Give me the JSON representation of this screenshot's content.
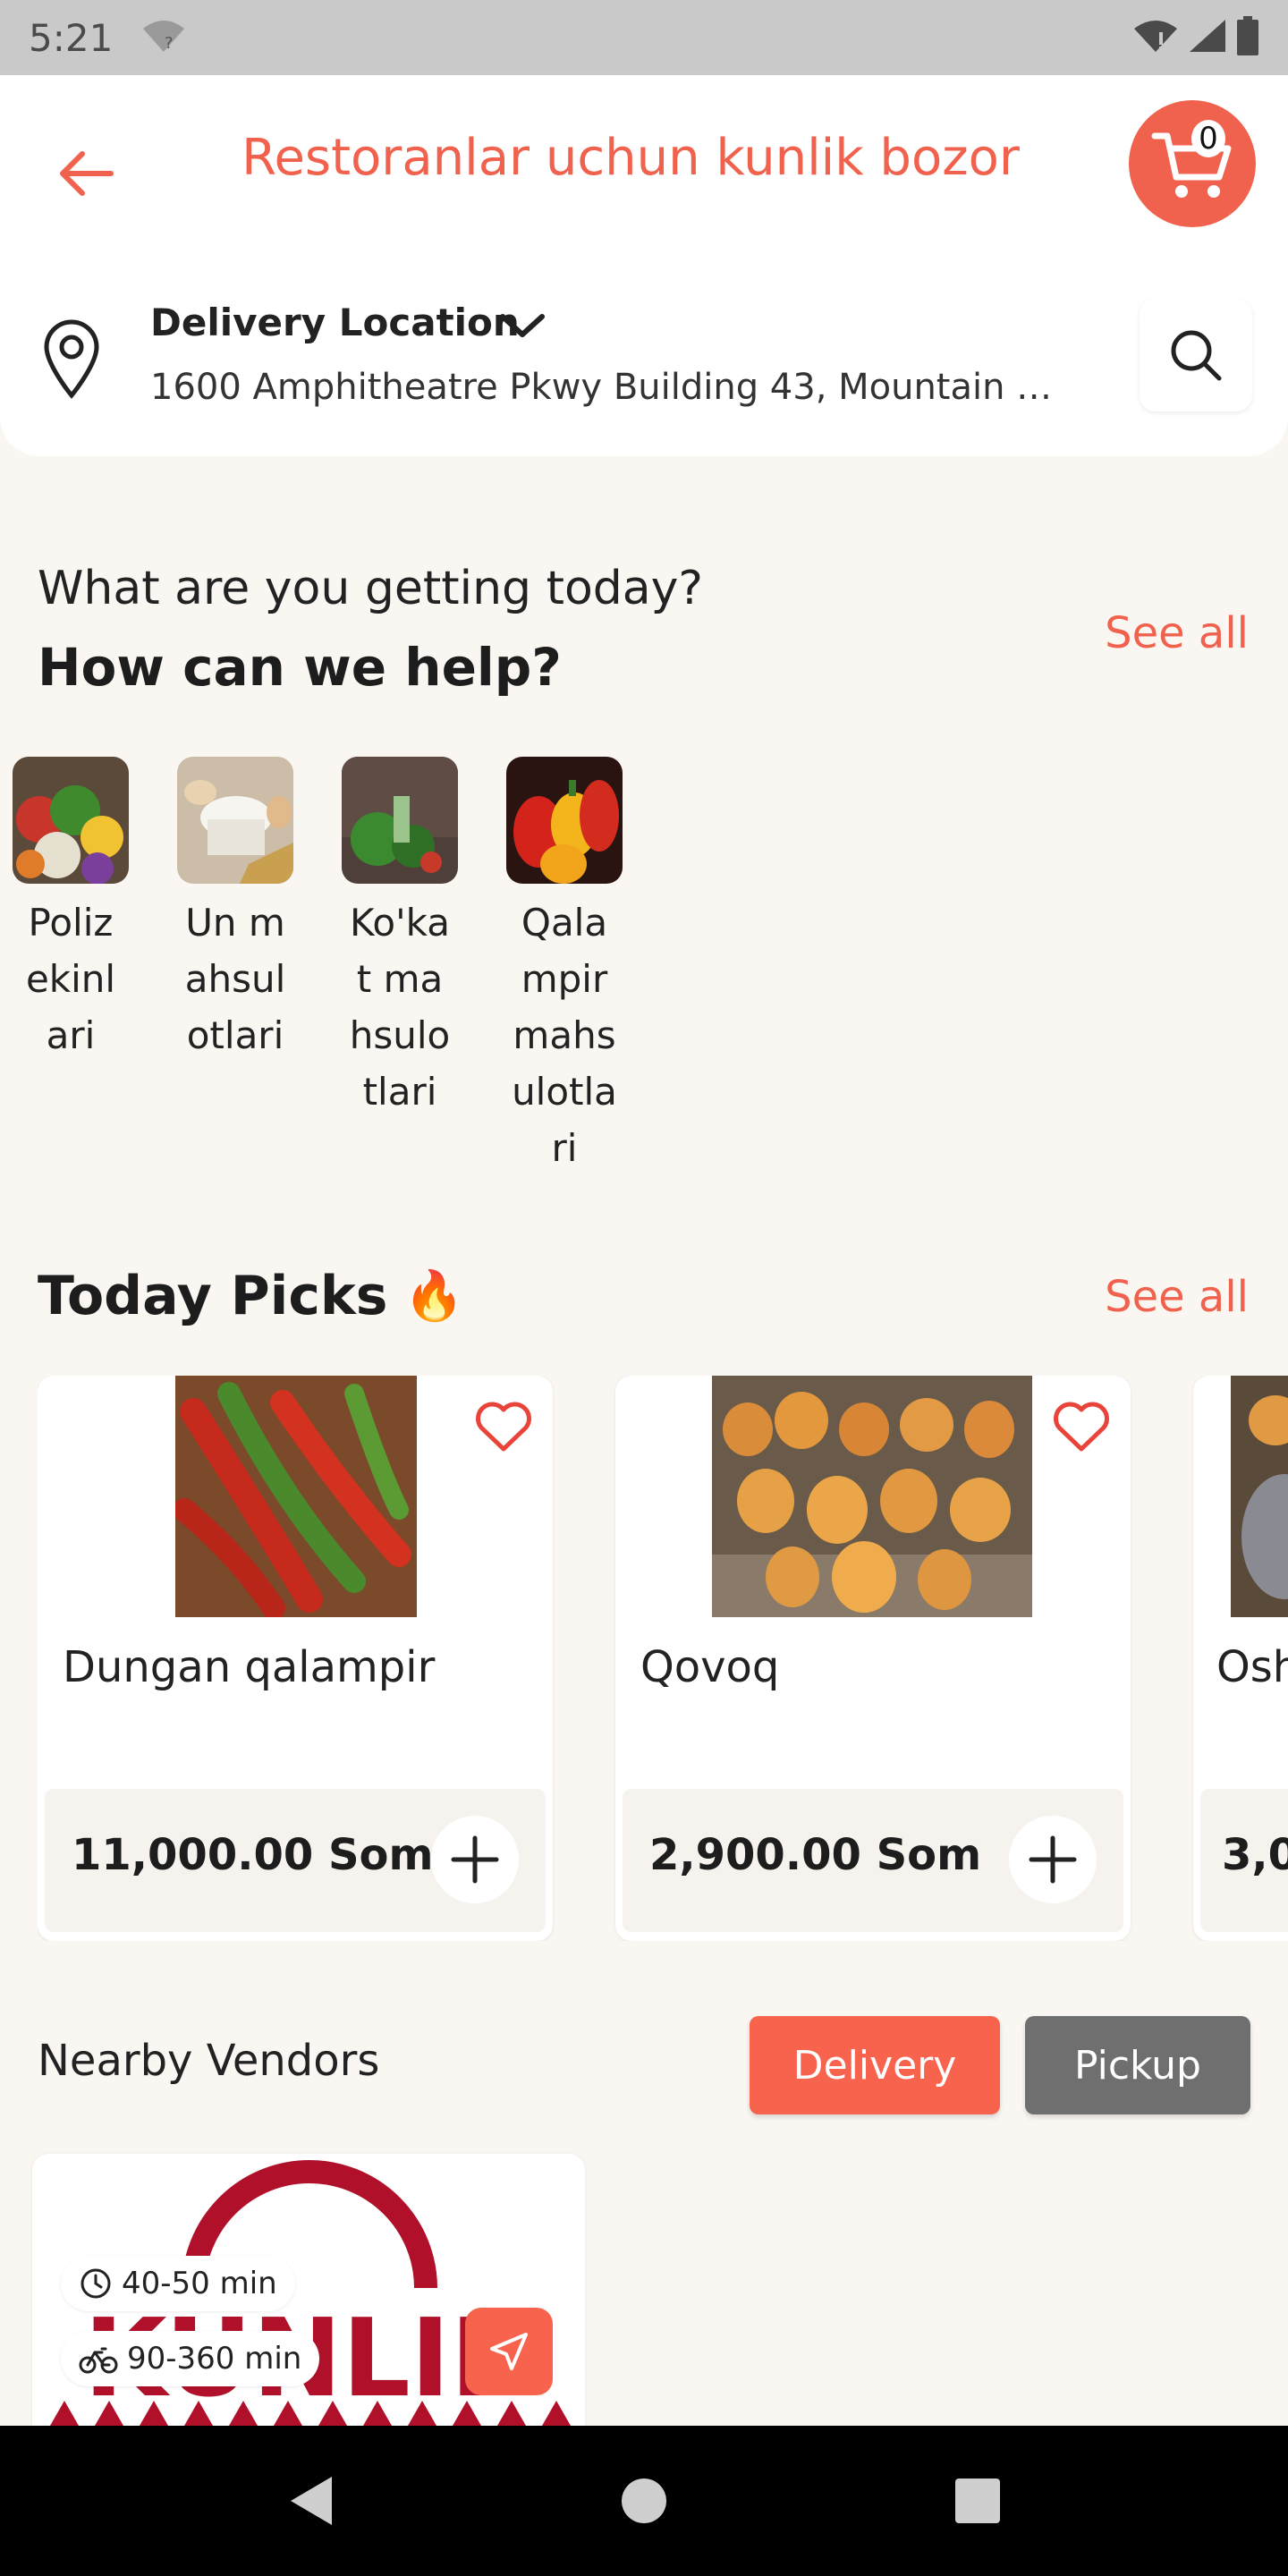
{
  "status_bar": {
    "time": "5:21",
    "wifi_hint": "?"
  },
  "header": {
    "title": "Restoranlar uchun kunlik bozor",
    "cart_count": "0",
    "delivery_label": "Delivery Location",
    "address": "1600 Amphitheatre Pkwy Building 43, Mountain …"
  },
  "help_section": {
    "subtitle": "What are you getting today?",
    "title": "How can we help?",
    "see_all": "See all",
    "categories": [
      {
        "label": "Poliz ekinlari"
      },
      {
        "label": "Un mahsulotlari"
      },
      {
        "label": "Ko'kat mahsulotlari"
      },
      {
        "label": "Qalampir mahsulotlari"
      }
    ]
  },
  "picks": {
    "title": "Today Picks",
    "emoji": "🔥",
    "see_all": "See all",
    "items": [
      {
        "name": "Dungan qalampir",
        "price": "11,000.00 Som"
      },
      {
        "name": "Qovoq",
        "price": "2,900.00 Som"
      },
      {
        "name": "Osh",
        "price": "3,0"
      }
    ]
  },
  "vendors": {
    "title": "Nearby Vendors",
    "delivery_label": "Delivery",
    "pickup_label": "Pickup",
    "cards": [
      {
        "prep_time": "40-50 min",
        "delivery_time": "90-360 min",
        "logo_text": "KUNLIK"
      }
    ]
  },
  "colors": {
    "accent": "#f0624d",
    "pickup": "#6f6f6f",
    "background": "#faf7f3"
  }
}
